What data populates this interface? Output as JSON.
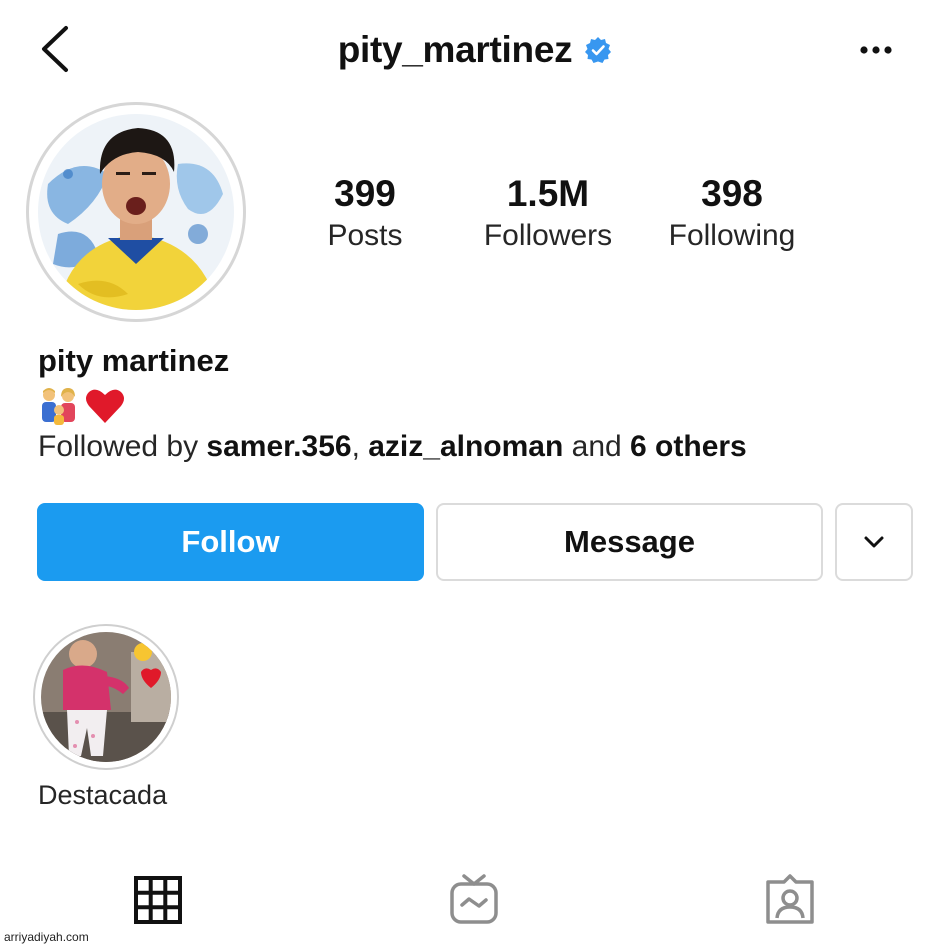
{
  "header": {
    "username": "pity_martinez",
    "back_icon": "chevron-left-icon",
    "verified_icon": "verified-badge-icon",
    "more_icon": "more-horizontal-icon"
  },
  "stats": {
    "posts": {
      "value": "399",
      "label": "Posts"
    },
    "followers": {
      "value": "1.5M",
      "label": "Followers"
    },
    "following": {
      "value": "398",
      "label": "Following"
    }
  },
  "bio": {
    "name": "pity martinez",
    "emojis": [
      "family-emoji",
      "red-heart-emoji"
    ],
    "followed_by": {
      "prefix": "Followed by ",
      "user1": "samer.356",
      "separator": ", ",
      "user2": "aziz_alnoman",
      "conjunction": " and ",
      "others": "6 others"
    }
  },
  "buttons": {
    "follow": "Follow",
    "message": "Message",
    "dropdown_icon": "chevron-down-icon"
  },
  "highlights": [
    {
      "label": "Destacada"
    }
  ],
  "tabs": [
    {
      "icon": "grid-icon"
    },
    {
      "icon": "igtv-icon"
    },
    {
      "icon": "tagged-user-icon"
    }
  ],
  "watermark": "arriyadiyah.com",
  "colors": {
    "accent": "#1b9bf0",
    "verified": "#3897f0",
    "border": "#dbdbdb"
  }
}
